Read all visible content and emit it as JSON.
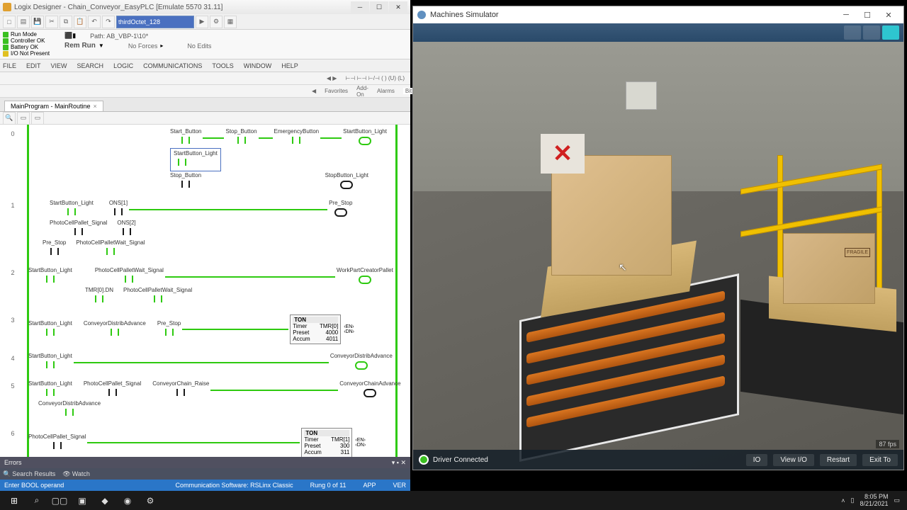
{
  "logix": {
    "title": "Logix Designer - Chain_Conveyor_EasyPLC [Emulate 5570 31.11]",
    "path_combo": "thirdOctet_128",
    "status": {
      "run_mode": "Run Mode",
      "controller": "Controller OK",
      "battery": "Battery OK",
      "io": "I/O Not Present"
    },
    "rem_run": "Rem Run",
    "no_forces": "No Forces",
    "no_edits": "No Edits",
    "path_label": "Path:",
    "path_value": "AB_VBP-1\\10*",
    "menu": [
      "FILE",
      "EDIT",
      "VIEW",
      "SEARCH",
      "LOGIC",
      "COMMUNICATIONS",
      "TOOLS",
      "WINDOW",
      "HELP"
    ],
    "ribbon_tabs": [
      "Favorites",
      "Add-On",
      "Alarms",
      "Bit"
    ],
    "tab": "MainProgram - MainRoutine",
    "rungs": [
      {
        "n": "0",
        "tags": [
          "Start_Button",
          "Stop_Button",
          "EmergencyButton",
          "StartButton_Light"
        ],
        "branch": "StartButton_Light",
        "b2_l": "Stop_Button",
        "b2_r": "StopButton_Light"
      },
      {
        "n": "1",
        "tags_l": [
          "StartButton_Light",
          "ONS[1]"
        ],
        "out": "Pre_Stop",
        "r2": [
          "PhotoCellPallet_Signal",
          "ONS[2]"
        ],
        "r3": [
          "Pre_Stop",
          "PhotoCellPalletWait_Signal"
        ]
      },
      {
        "n": "2",
        "tags_l": [
          "StartButton_Light",
          "PhotoCellPalletWait_Signal"
        ],
        "out": "WorkPartCreatorPallet",
        "r2": [
          "TMR[0].DN",
          "PhotoCellPalletWait_Signal"
        ]
      },
      {
        "n": "3",
        "tags_l": [
          "StartButton_Light",
          "ConveyorDistribAdvance",
          "Pre_Stop"
        ],
        "ton": {
          "hdr": "TON",
          "timer": "TMR[0]",
          "preset": "4000",
          "accum": "4011"
        }
      },
      {
        "n": "4",
        "tags_l": [
          "StartButton_Light"
        ],
        "out": "ConveyorDistribAdvance"
      },
      {
        "n": "5",
        "tags_l": [
          "StartButton_Light",
          "PhotoCellPallet_Signal",
          "ConveyorChain_Raise"
        ],
        "out": "ConveyorChainAdvance",
        "r2": [
          "ConveyorDistribAdvance"
        ]
      },
      {
        "n": "6",
        "tags_l": [
          "PhotoCellPallet_Signal"
        ],
        "ton": {
          "hdr": "TON",
          "timer": "TMR[1]",
          "preset": "300",
          "accum": "311"
        }
      }
    ],
    "errors_label": "Errors",
    "tabs_bottom": {
      "search": "Search Results",
      "watch": "Watch"
    },
    "status_bar": {
      "hint": "Enter BOOL operand",
      "comm": "Communication Software: RSLinx Classic",
      "rung": "Rung 0 of 11",
      "app": "APP",
      "ver": "VER"
    }
  },
  "sim": {
    "title": "Machines Simulator",
    "driver": "Driver Connected",
    "io": "IO",
    "view_io": "View I/O",
    "restart": "Restart",
    "exit": "Exit To",
    "fps": "87 fps",
    "box2_label": "FRAGILE"
  },
  "taskbar": {
    "time": "8:05 PM",
    "date": "8/21/2021"
  }
}
